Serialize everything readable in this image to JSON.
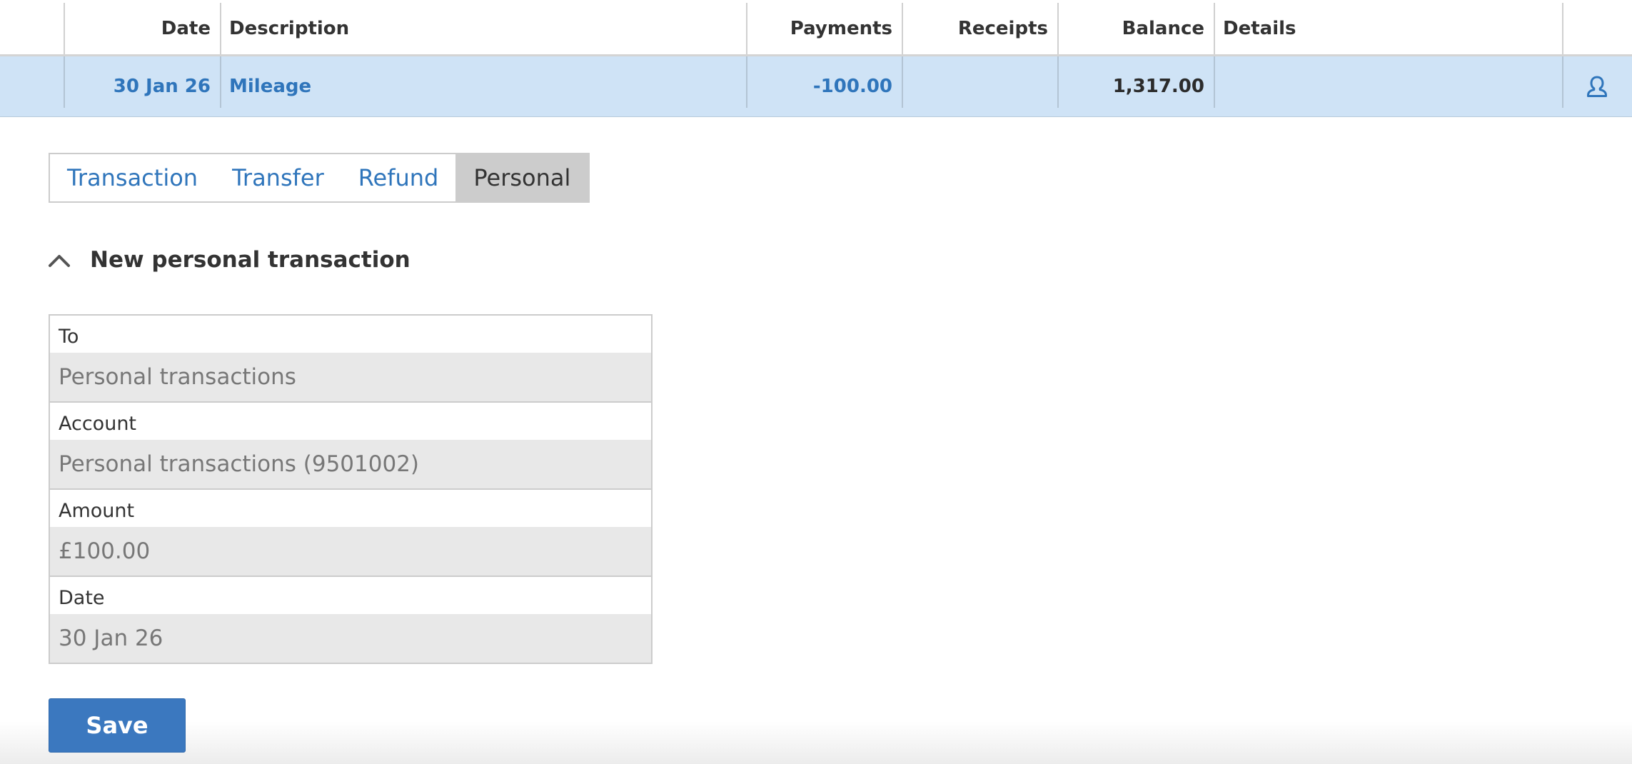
{
  "table": {
    "headers": {
      "date": "Date",
      "description": "Description",
      "payments": "Payments",
      "receipts": "Receipts",
      "balance": "Balance",
      "details": "Details"
    },
    "rows": [
      {
        "date": "30 Jan 26",
        "description": "Mileage",
        "payments": "-100.00",
        "receipts": "",
        "balance": "1,317.00",
        "details": "",
        "action_icon": "person-icon"
      }
    ]
  },
  "tabs": [
    {
      "label": "Transaction",
      "active": false
    },
    {
      "label": "Transfer",
      "active": false
    },
    {
      "label": "Refund",
      "active": false
    },
    {
      "label": "Personal",
      "active": true
    }
  ],
  "section": {
    "icon": "chevron-up-icon",
    "title": "New personal transaction"
  },
  "form": {
    "fields": [
      {
        "label": "To",
        "value": "Personal transactions"
      },
      {
        "label": "Account",
        "value": "Personal transactions (9501002)"
      },
      {
        "label": "Amount",
        "value": "£100.00"
      },
      {
        "label": "Date",
        "value": "30 Jan 26"
      }
    ]
  },
  "save_label": "Save",
  "colors": {
    "link": "#2f75bb",
    "selected_row": "#cfe3f6",
    "active_tab": "#cccccc",
    "primary_button": "#3b78bf",
    "readonly_field": "#e8e8e8"
  }
}
